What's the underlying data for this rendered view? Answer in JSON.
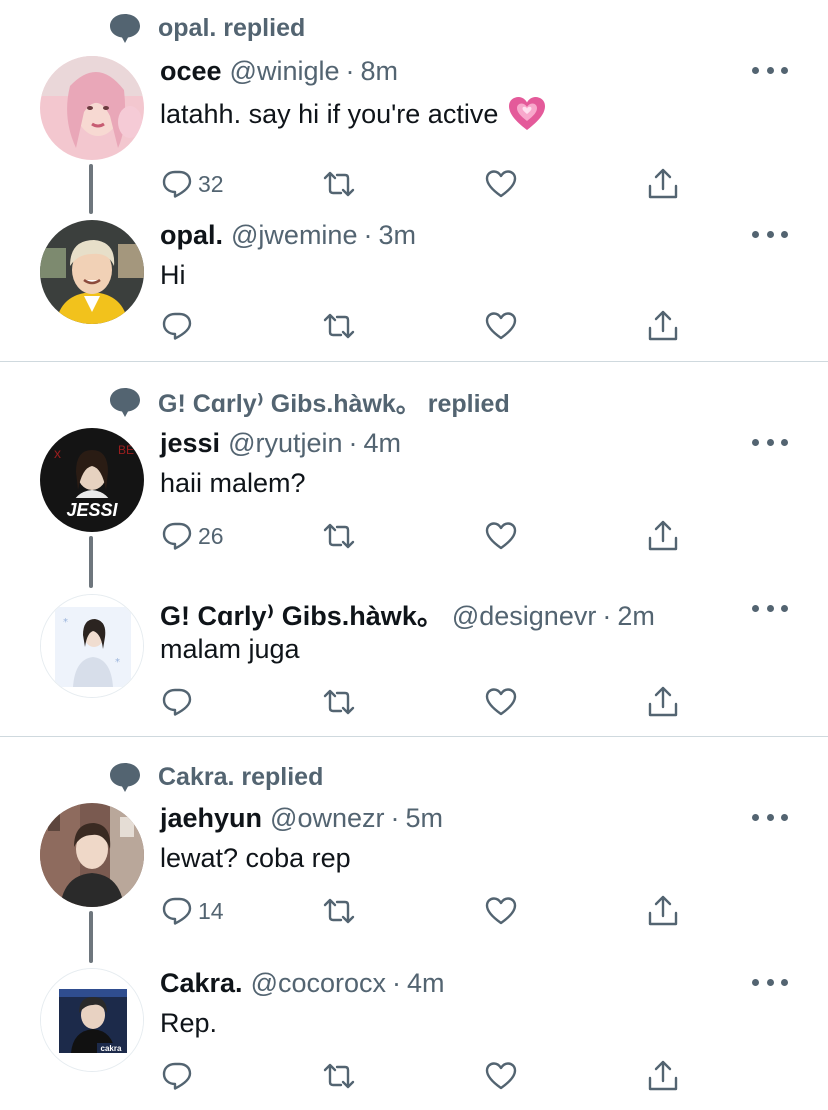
{
  "colors": {
    "text": "#0f1419",
    "secondary": "#536471",
    "divider": "#cfd9de",
    "thread_line": "#6e767d"
  },
  "separator": "·",
  "groups": [
    {
      "context": {
        "icon": "speech-bubble-icon",
        "text": "opal. replied"
      },
      "tweets": [
        {
          "name": "ocee",
          "handle": "@winigle",
          "time": "8m",
          "text": "latahh. say hi if you're active",
          "emoji": "growing-heart-emoji",
          "reply_count": "32",
          "avatar": "pink-photo-avatar"
        },
        {
          "name": "opal.",
          "handle": "@jwemine",
          "time": "3m",
          "text": "Hi",
          "reply_count": "",
          "avatar": "yellow-jacket-avatar"
        }
      ]
    },
    {
      "context": {
        "icon": "speech-bubble-icon",
        "text": "G! Cɑrly⁾ Gibs.hàwk。 replied"
      },
      "tweets": [
        {
          "name": "jessi",
          "handle": "@ryutjein",
          "time": "4m",
          "text": "haii malem?",
          "reply_count": "26",
          "avatar": "jessi-logo-avatar",
          "avatar_text": "JESSI"
        },
        {
          "name": "G! Cɑrly⁾ Gibs.hàwk。",
          "handle": "@designevr",
          "time": "2m",
          "text": "malam juga",
          "reply_count": "",
          "avatar": "light-blue-avatar"
        }
      ]
    },
    {
      "context": {
        "icon": "speech-bubble-icon",
        "text": "Cakra. replied"
      },
      "tweets": [
        {
          "name": "jaehyun",
          "handle": "@ownezr",
          "time": "5m",
          "text": "lewat? coba rep",
          "reply_count": "14",
          "avatar": "street-photo-avatar"
        },
        {
          "name": "Cakra.",
          "handle": "@cocorocx",
          "time": "4m",
          "text": "Rep.",
          "reply_count": "",
          "avatar": "cakra-card-avatar",
          "avatar_text": "cakra"
        }
      ]
    }
  ]
}
